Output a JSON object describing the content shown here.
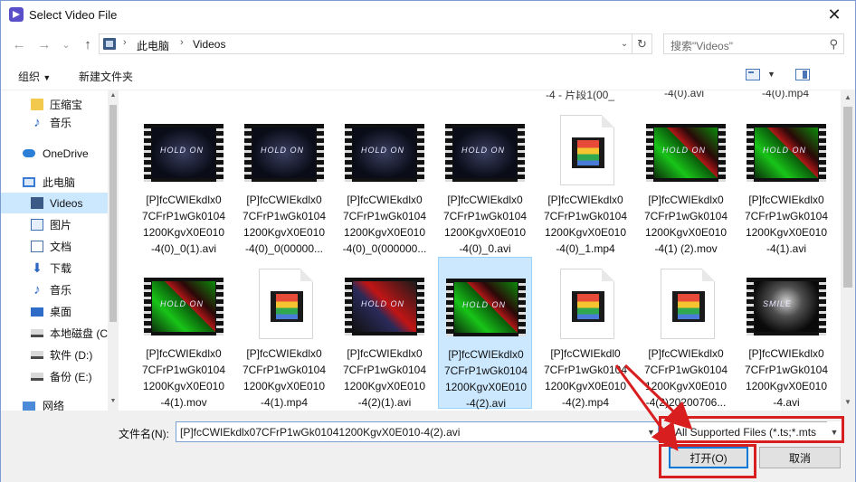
{
  "window": {
    "title": "Select Video File",
    "close_glyph": "✕"
  },
  "nav": {
    "back_glyph": "←",
    "forward_glyph": "→",
    "recent_glyph": "⌄",
    "up_glyph": "↑",
    "breadcrumb": [
      "此电脑",
      "Videos"
    ],
    "refresh_glyph": "↻",
    "search_placeholder": "搜索\"Videos\"",
    "search_glyph": "⚲"
  },
  "command_bar": {
    "organize": "组织",
    "new_folder": "新建文件夹"
  },
  "sidebar": {
    "items": [
      {
        "label": "压缩宝",
        "icon": "folder-icon",
        "kind": "folder"
      },
      {
        "label": "音乐",
        "icon": "music-icon",
        "kind": "note",
        "glyph": "♪"
      },
      {
        "label": "OneDrive",
        "icon": "cloud-icon",
        "kind": "cloud",
        "top": true
      },
      {
        "label": "此电脑",
        "icon": "computer-icon",
        "kind": "pc",
        "top": true
      },
      {
        "label": "Videos",
        "icon": "videos-icon",
        "kind": "videos",
        "selected": true
      },
      {
        "label": "图片",
        "icon": "pictures-icon",
        "kind": "pics"
      },
      {
        "label": "文档",
        "icon": "documents-icon",
        "kind": "docs"
      },
      {
        "label": "下载",
        "icon": "download-icon",
        "kind": "down",
        "glyph": "⬇"
      },
      {
        "label": "音乐",
        "icon": "music-icon",
        "kind": "note",
        "glyph": "♪"
      },
      {
        "label": "桌面",
        "icon": "desktop-icon",
        "kind": "desk"
      },
      {
        "label": "本地磁盘 (C",
        "icon": "disk-icon",
        "kind": "disk"
      },
      {
        "label": "软件 (D:)",
        "icon": "disk-icon",
        "kind": "disk"
      },
      {
        "label": "备份 (E:)",
        "icon": "disk-icon",
        "kind": "disk"
      },
      {
        "label": "网络",
        "icon": "network-icon",
        "kind": "net",
        "top": true
      }
    ]
  },
  "content": {
    "top_partial": [
      "-4 - 片段1(00_",
      "-4(0).avi",
      "-4(0).mp4"
    ],
    "files": [
      {
        "name": "[P]fcCWIEkdlx07CFrP1wGk01041200KgvX0E010-4(0)_0(1).avi",
        "lines": [
          "[P]fcCWIEkdlx0",
          "7CFrP1wGk0104",
          "1200KgvX0E010",
          "-4(0)_0(1).avi"
        ],
        "thumb": "video",
        "style": "dark",
        "caption": "HOLD ON"
      },
      {
        "name": "[P]fcCWIEkdlx07CFrP1wGk01041200KgvX0E010-4(0)_0(00000",
        "lines": [
          "[P]fcCWIEkdlx0",
          "7CFrP1wGk0104",
          "1200KgvX0E010",
          "-4(0)_0(00000..."
        ],
        "thumb": "video",
        "style": "dark",
        "caption": "HOLD ON"
      },
      {
        "name": "[P]fcCWIEkdlx07CFrP1wGk01041200KgvX0E010-4(0)_0(000000",
        "lines": [
          "[P]fcCWIEkdlx0",
          "7CFrP1wGk0104",
          "1200KgvX0E010",
          "-4(0)_0(000000..."
        ],
        "thumb": "video",
        "style": "dark",
        "caption": "HOLD ON"
      },
      {
        "name": "[P]fcCWIEkdlx07CFrP1wGk01041200KgvX0E010-4(0)_0.avi",
        "lines": [
          "[P]fcCWIEkdlx0",
          "7CFrP1wGk0104",
          "1200KgvX0E010",
          "-4(0)_0.avi"
        ],
        "thumb": "video",
        "style": "dark",
        "caption": "HOLD ON"
      },
      {
        "name": "[P]fcCWIEkdlx07CFrP1wGk01041200KgvX0E010-4(0)_1.mp4",
        "lines": [
          "[P]fcCWIEkdlx0",
          "7CFrP1wGk0104",
          "1200KgvX0E010",
          "-4(0)_1.mp4"
        ],
        "thumb": "doc"
      },
      {
        "name": "[P]fcCWIEkdlx07CFrP1wGk01041200KgvX0E010-4(1) (2).mov",
        "lines": [
          "[P]fcCWIEkdlx0",
          "7CFrP1wGk0104",
          "1200KgvX0E010",
          "-4(1) (2).mov"
        ],
        "thumb": "video",
        "style": "green",
        "caption": "HOLD ON"
      },
      {
        "name": "[P]fcCWIEkdlx07CFrP1wGk01041200KgvX0E010-4(1).avi",
        "lines": [
          "[P]fcCWIEkdlx0",
          "7CFrP1wGk0104",
          "1200KgvX0E010",
          "-4(1).avi"
        ],
        "thumb": "video",
        "style": "green",
        "caption": "HOLD ON"
      },
      {
        "name": "[P]fcCWIEkdlx07CFrP1wGk01041200KgvX0E010-4(1).mov",
        "lines": [
          "[P]fcCWIEkdlx0",
          "7CFrP1wGk0104",
          "1200KgvX0E010",
          "-4(1).mov"
        ],
        "thumb": "video",
        "style": "green",
        "caption": "HOLD ON"
      },
      {
        "name": "[P]fcCWIEkdlx07CFrP1wGk01041200KgvX0E010-4(1).mp4",
        "lines": [
          "[P]fcCWIEkdlx0",
          "7CFrP1wGk0104",
          "1200KgvX0E010",
          "-4(1).mp4"
        ],
        "thumb": "doc"
      },
      {
        "name": "[P]fcCWIEkdlx07CFrP1wGk01041200KgvX0E010-4(2)(1).avi",
        "lines": [
          "[P]fcCWIEkdlx0",
          "7CFrP1wGk0104",
          "1200KgvX0E010",
          "-4(2)(1).avi"
        ],
        "thumb": "video",
        "style": "mixed",
        "caption": "HOLD ON"
      },
      {
        "name": "[P]fcCWIEkdlx07CFrP1wGk01041200KgvX0E010-4(2).avi",
        "lines": [
          "[P]fcCWIEkdlx0",
          "7CFrP1wGk0104",
          "1200KgvX0E010",
          "-4(2).avi"
        ],
        "thumb": "video",
        "style": "green",
        "caption": "HOLD ON",
        "selected": true
      },
      {
        "name": "[P]fcCWIEkdlx07CFrP1wGk01041200KgvX0E010-4(2).mp4",
        "lines": [
          "[P]fcCWIEkdl0",
          "7CFrP1wGk0104",
          "1200KgvX0E010",
          "-4(2).mp4"
        ],
        "thumb": "doc"
      },
      {
        "name": "[P]fcCWIEkdlx07CFrP1wGk01041200KgvX0E010-4(2)20200706",
        "lines": [
          "[P]fcCWIEkdlx0",
          "7CFrP1wGk0104",
          "1200KgvX0E010",
          "-4(2)20200706..."
        ],
        "thumb": "doc"
      },
      {
        "name": "[P]fcCWIEkdlx07CFrP1wGk01041200KgvX0E010-4.avi",
        "lines": [
          "[P]fcCWIEkdlx0",
          "7CFrP1wGk0104",
          "1200KgvX0E010",
          "-4.avi"
        ],
        "thumb": "video",
        "style": "bw",
        "caption": "SMILE"
      }
    ]
  },
  "footer": {
    "filename_label": "文件名(N):",
    "filename_value": "[P]fcCWIEkdlx07CFrP1wGk01041200KgvX0E010-4(2).avi",
    "filter_value": "All Supported Files (*.ts;*.mts",
    "open_label": "打开(O)",
    "cancel_label": "取消"
  },
  "colors": {
    "selection": "#cce8ff",
    "highlight": "#d81e1e",
    "accent": "#0078d7"
  }
}
